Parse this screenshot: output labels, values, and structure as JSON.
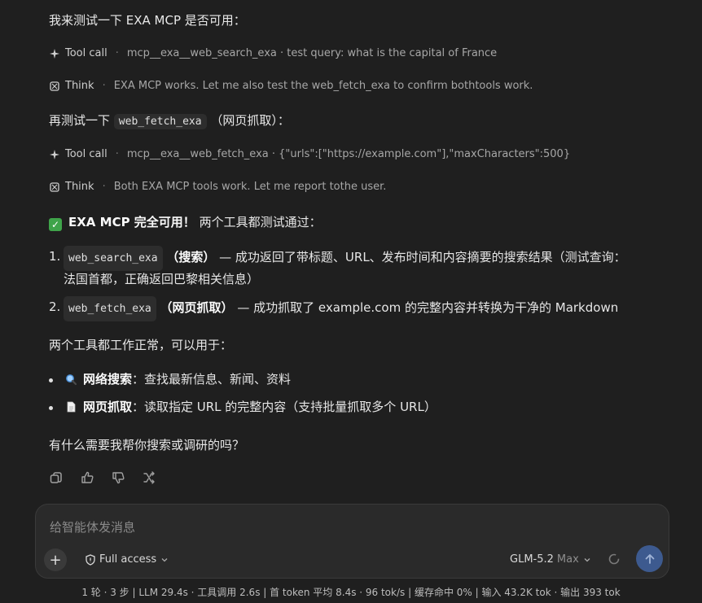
{
  "messages": {
    "intro": "我来测试一下 EXA MCP 是否可用：",
    "step1": {
      "label": "Tool call",
      "text": "mcp__exa__web_search_exa · test query: what is the capital of France"
    },
    "step2": {
      "label": "Think",
      "text": "EXA MCP works. Let me also test the web_fetch_exa to confirm bothtools work."
    },
    "retest_prefix": "再测试一下",
    "retest_code": "web_fetch_exa",
    "retest_suffix": "（网页抓取）：",
    "step3": {
      "label": "Tool call",
      "text": "mcp__exa__web_fetch_exa · {\"urls\":[\"https://example.com\"],\"maxCharacters\":500}"
    },
    "step4": {
      "label": "Think",
      "text": "Both EXA MCP tools work. Let me report tothe user."
    },
    "result_bold": "EXA MCP 完全可用！",
    "result_rest": " 两个工具都测试通过：",
    "list": [
      {
        "num": "1.",
        "code": "web_search_exa",
        "bold": "（搜索）",
        "text": " — 成功返回了带标题、URL、发布时间和内容摘要的搜索结果（测试查询：",
        "text2": "法国首都，正确返回巴黎相关信息）"
      },
      {
        "num": "2.",
        "code": "web_fetch_exa",
        "bold": "（网页抓取）",
        "text": " — 成功抓取了 example.com 的完整内容并转换为干净的 Markdown"
      }
    ],
    "usable_for": "两个工具都工作正常，可以用于：",
    "bullets": [
      {
        "bold": "网络搜索",
        "text": "：查找最新信息、新闻、资料"
      },
      {
        "bold": "网页抓取",
        "text": "：读取指定 URL 的完整内容（支持批量抓取多个 URL）"
      }
    ],
    "closing": "有什么需要我帮你搜索或调研的吗？"
  },
  "composer": {
    "placeholder": "给智能体发消息",
    "access_label": "Full access",
    "model_name": "GLM-5.2",
    "model_tier": "Max"
  },
  "status_bar": "1 轮 · 3 步  |  LLM 29.4s · 工具调用 2.6s  |  首 token 平均 8.4s · 96 tok/s  |  缓存命中 0%  |  输入 43.2K tok · 输出 393 tok",
  "colors": {
    "accent_send": "#3d5a8f",
    "check_green": "#3fa44a"
  }
}
